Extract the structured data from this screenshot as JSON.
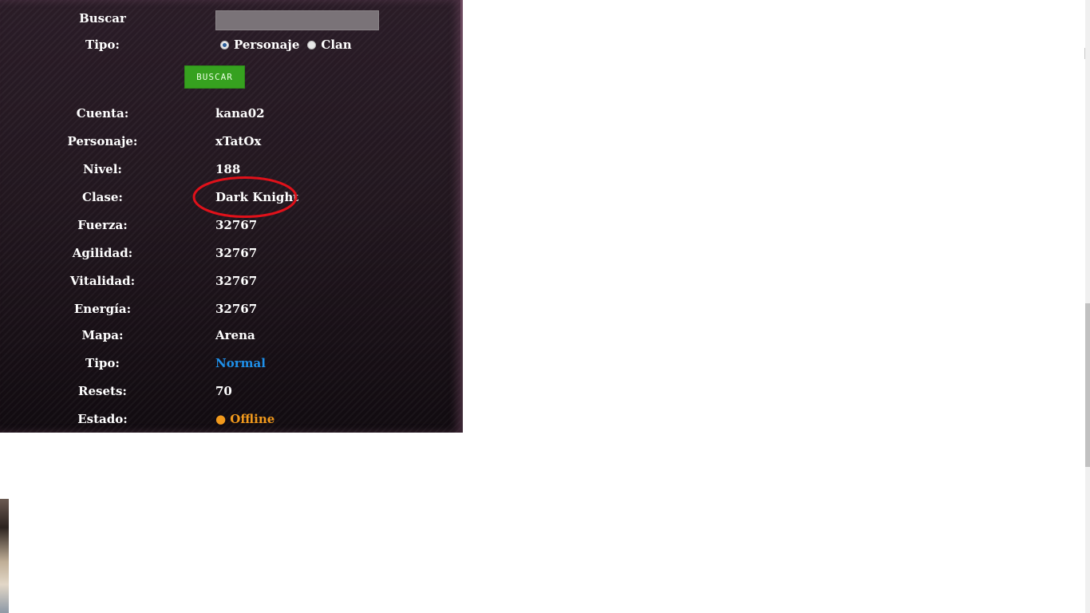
{
  "search": {
    "label": "Buscar",
    "value": "",
    "placeholder": ""
  },
  "type_filter": {
    "label": "Tipo:",
    "options": [
      {
        "label": "Personaje",
        "checked": true
      },
      {
        "label": "Clan",
        "checked": false
      }
    ]
  },
  "search_button": {
    "label": "BUSCAR",
    "color": "#36a11f"
  },
  "profile": {
    "rows": [
      {
        "label": "Cuenta:",
        "value": "kana02"
      },
      {
        "label": "Personaje:",
        "value": "xTatOx"
      },
      {
        "label": "Nivel:",
        "value": "188"
      },
      {
        "label": "Clase:",
        "value": "Dark Knight"
      },
      {
        "label": "Fuerza:",
        "value": "32767"
      },
      {
        "label": "Agilidad:",
        "value": "32767"
      },
      {
        "label": "Vitalidad:",
        "value": "32767"
      },
      {
        "label": "Energía:",
        "value": "32767"
      },
      {
        "label": "Mapa:",
        "value": "Arena"
      },
      {
        "label": "Tipo:",
        "value": "Normal",
        "color": "#1f8fe8"
      },
      {
        "label": "Resets:",
        "value": "70"
      },
      {
        "label": "Estado:",
        "value": "● Offline",
        "color": "#f29a1c"
      }
    ]
  },
  "annotation": {
    "shape": "ellipse",
    "color": "#e0111a",
    "target": "Clase value"
  }
}
